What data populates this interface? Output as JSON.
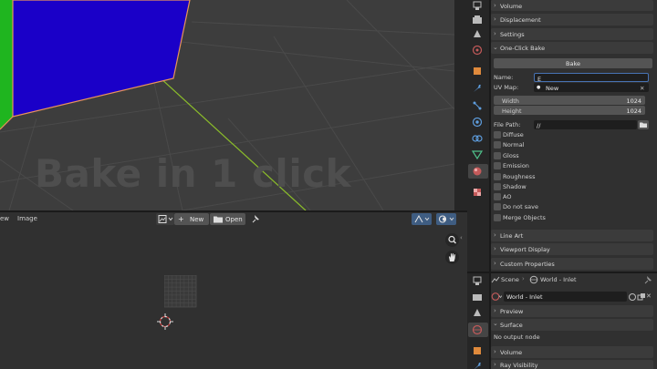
{
  "viewport": {
    "overlay_text": "Bake in 1 click"
  },
  "image_editor": {
    "menu": [
      "ew",
      "Image"
    ],
    "new_label": "New",
    "open_label": "Open"
  },
  "properties": {
    "collapsed_top": [
      "Volume",
      "Displacement",
      "Settings"
    ],
    "panel_title": "One-Click Bake",
    "bake_button": "Bake",
    "name_label": "Name:",
    "name_value": "E",
    "uvmap_label": "UV Map:",
    "uvmap_value": "New",
    "width_label": "Width",
    "width_value": "1024",
    "height_label": "Height",
    "height_value": "1024",
    "filepath_label": "File Path:",
    "filepath_value": "//",
    "checkboxes": [
      "Diffuse",
      "Normal",
      "Gloss",
      "Emission",
      "Roughness",
      "Shadow",
      "AO",
      "Do not save",
      "Merge Objects"
    ],
    "collapsed_bottom": [
      "Line Art",
      "Viewport Display",
      "Custom Properties"
    ]
  },
  "world": {
    "breadcrumb_scene": "Scene",
    "breadcrumb_world": "World - Inlet",
    "world_selector": "World - Inlet",
    "sections": [
      "Preview",
      "Surface",
      "Volume",
      "Ray Visibility"
    ],
    "surface_text": "No output node"
  },
  "colors": {
    "accent_blue": "#1a00c8",
    "accent_green": "#1fb51f",
    "selection_outline": "#e8935c",
    "y_axis": "#8bbd2a"
  }
}
